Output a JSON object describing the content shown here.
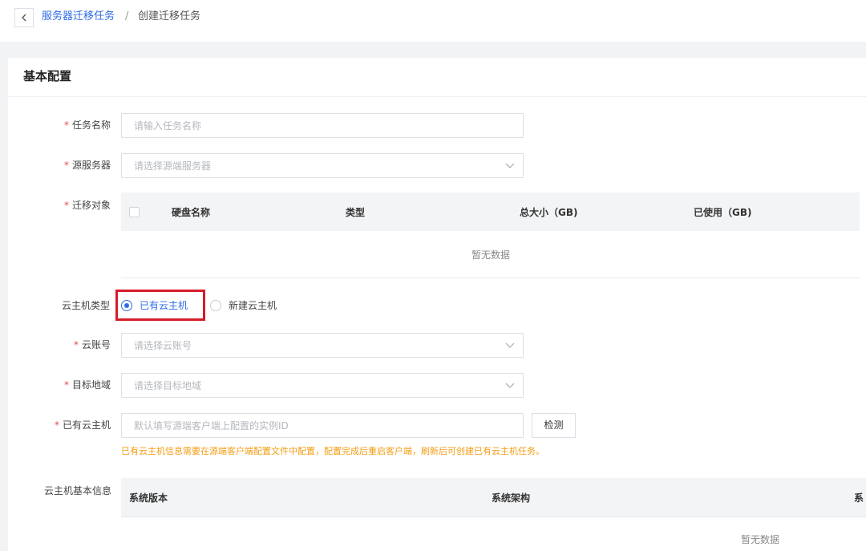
{
  "breadcrumb": {
    "parent": "服务器迁移任务",
    "separator": "/",
    "current": "创建迁移任务"
  },
  "card": {
    "title": "基本配置"
  },
  "form": {
    "task_name": {
      "label": "任务名称",
      "placeholder": "请输入任务名称"
    },
    "source_server": {
      "label": "源服务器",
      "placeholder": "请选择源端服务器"
    },
    "migration_target": {
      "label": "迁移对象",
      "columns": [
        "硬盘名称",
        "类型",
        "总大小（GB)",
        "已使用（GB)"
      ],
      "empty": "暂无数据"
    },
    "host_type": {
      "label": "云主机类型",
      "options": [
        "已有云主机",
        "新建云主机"
      ],
      "selected": "已有云主机"
    },
    "cloud_account": {
      "label": "云账号",
      "placeholder": "请选择云账号"
    },
    "target_region": {
      "label": "目标地域",
      "placeholder": "请选择目标地域"
    },
    "existing_host": {
      "label": "已有云主机",
      "placeholder": "默认填写源端客户端上配置的实例ID",
      "button": "检测",
      "hint": "已有云主机信息需要在源端客户端配置文件中配置，配置完成后重启客户端，刷新后可创建已有云主机任务。"
    },
    "host_info": {
      "label": "云主机基本信息",
      "columns": [
        "系统版本",
        "系统架构",
        "系"
      ],
      "empty": "暂无数据"
    }
  },
  "colors": {
    "accent": "#2e6be6",
    "required": "#e34d59",
    "highlight": "#d51c2a",
    "hint": "#f39c12"
  }
}
